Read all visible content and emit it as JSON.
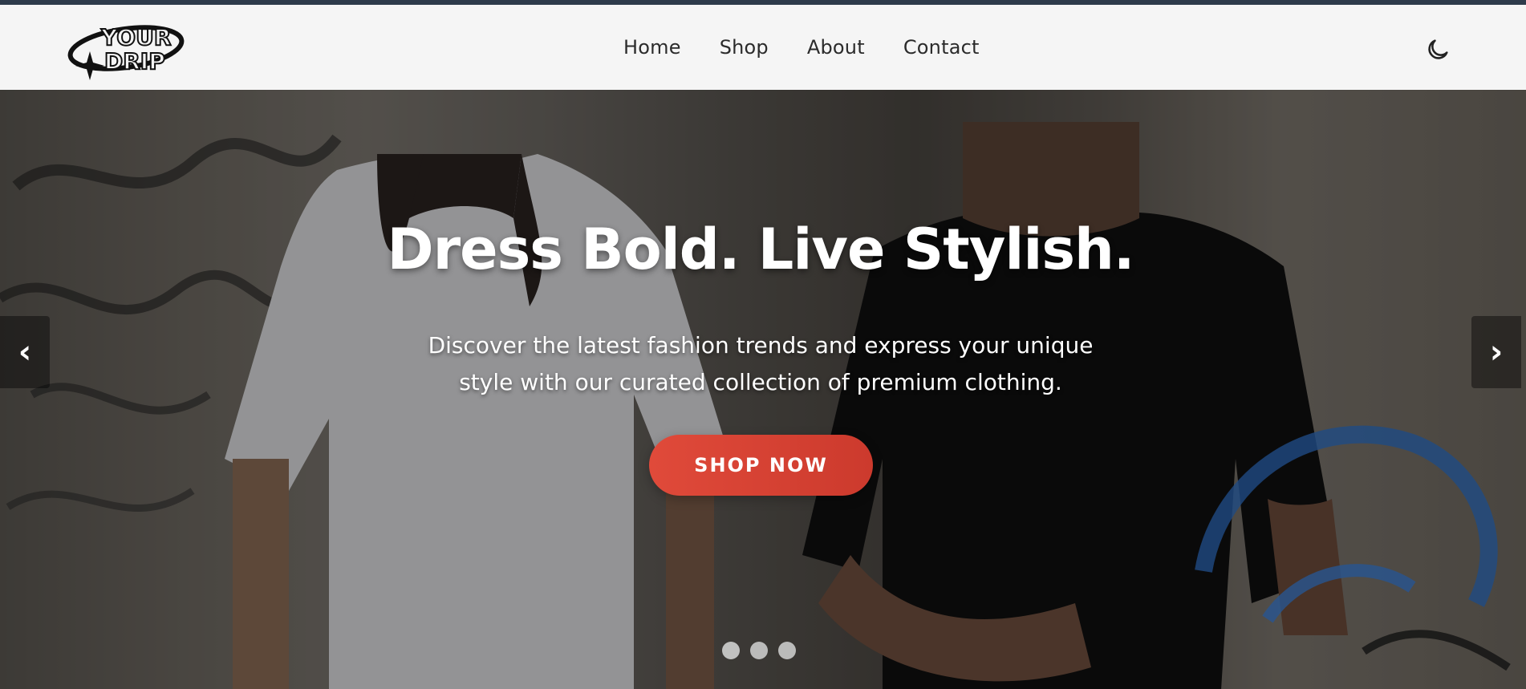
{
  "brand": {
    "logo_text_line1": "YOUR",
    "logo_text_line2": "DRIP"
  },
  "nav": {
    "items": [
      {
        "label": "Home"
      },
      {
        "label": "Shop"
      },
      {
        "label": "About"
      },
      {
        "label": "Contact"
      }
    ],
    "theme_toggle_icon": "moon-icon"
  },
  "hero": {
    "title": "Dress Bold. Live Stylish.",
    "subtitle_line1": "Discover the latest fashion trends and express your unique",
    "subtitle_line2": "style with our curated collection of premium clothing.",
    "cta_label": "SHOP NOW",
    "prev_arrow": "‹",
    "next_arrow": "›",
    "slides_count": 3,
    "active_slide": 1
  },
  "colors": {
    "accent": "#d9412f",
    "header_bg": "#f5f5f5",
    "top_strip": "#2e3b4b",
    "nav_text": "#2b2b2b"
  }
}
